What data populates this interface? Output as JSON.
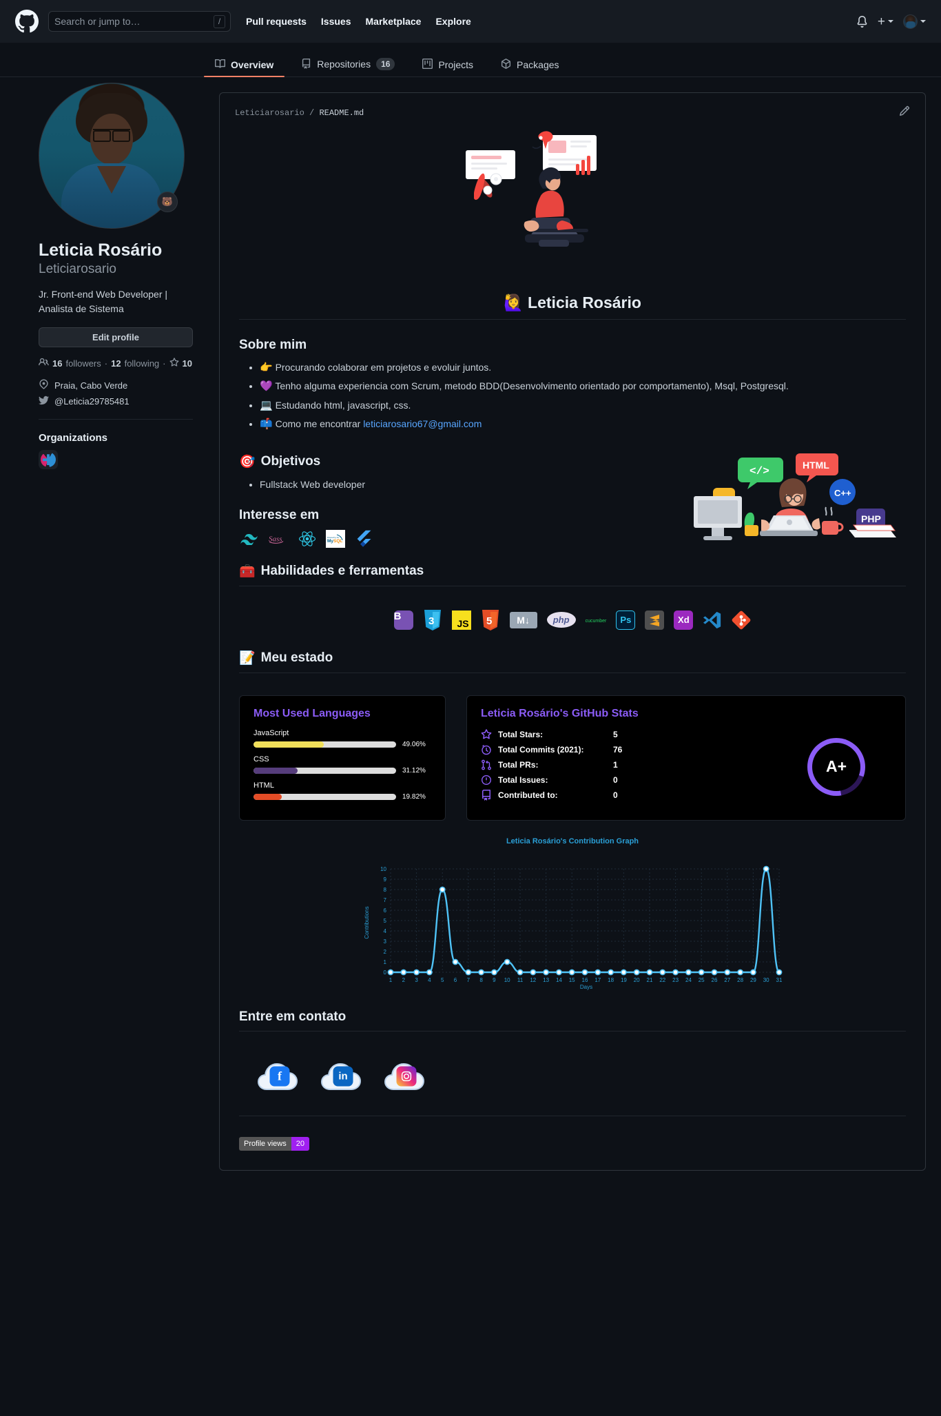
{
  "header": {
    "logo_icon": "github-logo-icon",
    "search": {
      "placeholder": "Search or jump to…",
      "value": "",
      "shortcut": "/"
    },
    "nav": [
      {
        "label": "Pull requests"
      },
      {
        "label": "Issues"
      },
      {
        "label": "Marketplace"
      },
      {
        "label": "Explore"
      }
    ],
    "notifications_icon": "bell-icon",
    "create_new_icon": "plus-icon",
    "account_icon": "avatar-icon"
  },
  "tabs": [
    {
      "label": "Overview",
      "icon": "book-icon",
      "count": "",
      "active": true
    },
    {
      "label": "Repositories",
      "icon": "repo-icon",
      "count": "16",
      "active": false
    },
    {
      "label": "Projects",
      "icon": "project-icon",
      "count": "",
      "active": false
    },
    {
      "label": "Packages",
      "icon": "package-icon",
      "count": "",
      "active": false
    }
  ],
  "profile": {
    "avatar_status_emoji": "🐻",
    "fullname": "Leticia Rosário",
    "username": "Leticiarosario",
    "bio": "Jr. Front-end Web Developer | Analista de Sistema",
    "edit_button": "Edit profile",
    "followers_count": "16",
    "followers_label": "followers",
    "following_count": "12",
    "following_label": "following",
    "stars_count": "10",
    "location": "Praia, Cabo Verde",
    "twitter": "@Leticia29785481",
    "organizations_title": "Organizations",
    "organizations": [
      {
        "name": "org-avatar"
      }
    ]
  },
  "readme": {
    "owner": "Leticiarosario",
    "separator": "/",
    "filename": "README.md",
    "edit_icon": "pencil-icon",
    "heading": "🙋‍♀️ Leticia Rosário",
    "sections": {
      "about": {
        "title": "Sobre mim",
        "items": [
          {
            "emoji": "👉",
            "text": "Procurando colaborar em projetos e evoluir juntos."
          },
          {
            "emoji": "💜",
            "text": "Tenho alguma experiencia com Scrum, metodo BDD(Desenvolvimento orientado por comportamento), Msql, Postgresql."
          },
          {
            "emoji": "💻",
            "text": "Estudando html, javascript, css."
          },
          {
            "emoji": "📫",
            "text": "Como me encontrar ",
            "link": "leticiarosario67@gmail.com"
          }
        ]
      },
      "goals": {
        "emoji": "🎯",
        "title": "Objetivos",
        "items": [
          {
            "text": "Fullstack Web developer"
          }
        ]
      },
      "interests": {
        "title": "Interesse em",
        "badges": [
          {
            "name": "tailwindcss-icon"
          },
          {
            "name": "sass-icon"
          },
          {
            "name": "react-icon"
          },
          {
            "name": "mysql-icon"
          },
          {
            "name": "flutter-icon"
          }
        ]
      },
      "skills": {
        "emoji": "🧰",
        "title": "Habilidades e ferramentas",
        "badges": [
          {
            "name": "bootstrap-icon",
            "label": "B"
          },
          {
            "name": "css3-icon",
            "label": "3"
          },
          {
            "name": "javascript-icon",
            "label": "JS"
          },
          {
            "name": "html5-icon",
            "label": "5"
          },
          {
            "name": "markdown-icon",
            "label": "M"
          },
          {
            "name": "php-icon",
            "label": "php"
          },
          {
            "name": "cucumber-icon",
            "label": "cucumber"
          },
          {
            "name": "photoshop-icon",
            "label": "Ps"
          },
          {
            "name": "sublime-text-icon",
            "label": "S"
          },
          {
            "name": "adobe-xd-icon",
            "label": "Xd"
          },
          {
            "name": "vscode-icon",
            "label": "VS"
          },
          {
            "name": "git-icon",
            "label": "git"
          }
        ]
      },
      "status": {
        "emoji": "📝",
        "title": "Meu estado"
      },
      "contact": {
        "title": "Entre em contato",
        "socials": [
          {
            "name": "facebook-icon",
            "label": "f",
            "color": "#1877f2"
          },
          {
            "name": "linkedin-icon",
            "label": "in",
            "color": "#0a66c2"
          },
          {
            "name": "instagram-icon",
            "label": "ig",
            "color": "#c13584"
          }
        ]
      }
    },
    "profile_views": {
      "label": "Profile views",
      "count": "20"
    }
  },
  "chart_data": [
    {
      "type": "bar",
      "title": "Most Used Languages",
      "categories": [
        "JavaScript",
        "CSS",
        "HTML"
      ],
      "values": [
        49.06,
        31.12,
        19.82
      ],
      "value_labels": [
        "49.06%",
        "31.12%",
        "19.82%"
      ],
      "colors": [
        "#f1e05a",
        "#563d7c",
        "#e34c26"
      ],
      "xlabel": "",
      "ylabel": "",
      "ylim": [
        0,
        100
      ],
      "grid": false,
      "legend": "none"
    },
    {
      "type": "table",
      "title": "Leticia Rosário's GitHub Stats",
      "rank": "A+",
      "rows": [
        {
          "icon": "star-icon",
          "label": "Total Stars:",
          "value": "5"
        },
        {
          "icon": "clock-icon",
          "label": "Total Commits (2021):",
          "value": "76"
        },
        {
          "icon": "pull-request-icon",
          "label": "Total PRs:",
          "value": "1"
        },
        {
          "icon": "issue-icon",
          "label": "Total Issues:",
          "value": "0"
        },
        {
          "icon": "repo-icon",
          "label": "Contributed to:",
          "value": "0"
        }
      ]
    },
    {
      "type": "line",
      "title": "Leticia Rosário's Contribution Graph",
      "xlabel": "Days",
      "ylabel": "Contributions",
      "x": [
        1,
        2,
        3,
        4,
        5,
        6,
        7,
        8,
        9,
        10,
        11,
        12,
        13,
        14,
        15,
        16,
        17,
        18,
        19,
        20,
        21,
        22,
        23,
        24,
        25,
        26,
        27,
        28,
        29,
        30,
        31
      ],
      "values": [
        0,
        0,
        0,
        0,
        8,
        1,
        0,
        0,
        0,
        1,
        0,
        0,
        0,
        0,
        0,
        0,
        0,
        0,
        0,
        0,
        0,
        0,
        0,
        0,
        0,
        0,
        0,
        0,
        0,
        10,
        0
      ],
      "ylim": [
        0,
        10
      ],
      "yticks": [
        0,
        1,
        2,
        3,
        4,
        5,
        6,
        7,
        8,
        9,
        10
      ],
      "grid": true,
      "legend": "none",
      "line_color": "#4fc3f7"
    }
  ]
}
